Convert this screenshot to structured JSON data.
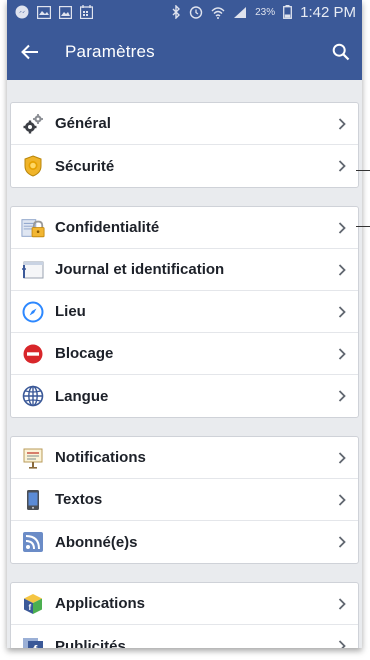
{
  "status_bar": {
    "battery_percent": "23%",
    "time": "1:42 PM",
    "icons": [
      "messenger-icon",
      "gallery-icon",
      "image-icon",
      "calendar-icon",
      "bluetooth-icon",
      "alarm-icon",
      "wifi-icon",
      "signal-icon",
      "battery-icon"
    ]
  },
  "app_bar": {
    "title": "Paramètres",
    "back_icon": "arrow-back-icon",
    "search_icon": "search-icon"
  },
  "groups": [
    {
      "items": [
        {
          "label": "Général",
          "icon": "gears-icon"
        },
        {
          "label": "Sécurité",
          "icon": "security-badge-icon"
        }
      ]
    },
    {
      "items": [
        {
          "label": "Confidentialité",
          "icon": "privacy-lock-icon"
        },
        {
          "label": "Journal et identification",
          "icon": "timeline-icon"
        },
        {
          "label": "Lieu",
          "icon": "compass-icon"
        },
        {
          "label": "Blocage",
          "icon": "block-icon"
        },
        {
          "label": "Langue",
          "icon": "globe-icon"
        }
      ]
    },
    {
      "items": [
        {
          "label": "Notifications",
          "icon": "notifications-sign-icon"
        },
        {
          "label": "Textos",
          "icon": "phone-text-icon"
        },
        {
          "label": "Abonné(e)s",
          "icon": "rss-icon"
        }
      ]
    },
    {
      "items": [
        {
          "label": "Applications",
          "icon": "apps-cube-icon"
        },
        {
          "label": "Publicités",
          "icon": "ads-icon"
        }
      ]
    }
  ],
  "colors": {
    "header": "#3b5998",
    "background": "#e9ebee",
    "text": "#1d2129",
    "chevron": "#616770"
  }
}
